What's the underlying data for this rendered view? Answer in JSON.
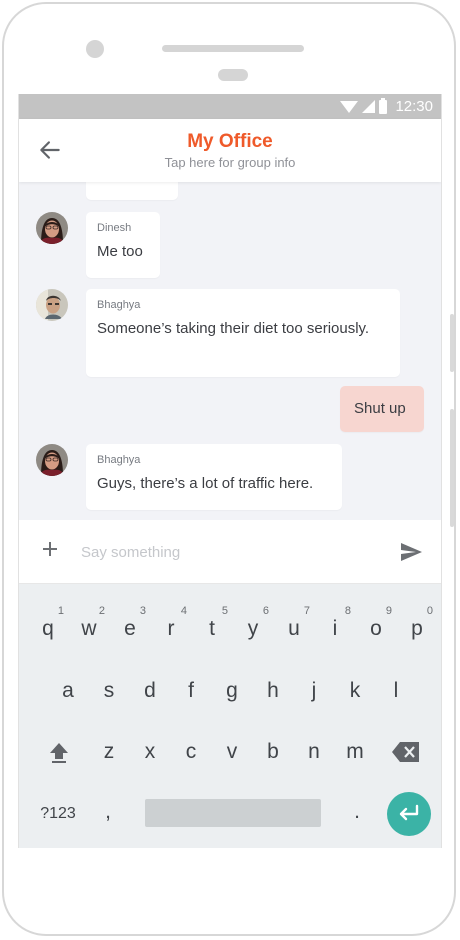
{
  "status_bar": {
    "time": "12:30"
  },
  "header": {
    "title": "My Office",
    "subtitle": "Tap here for group info"
  },
  "messages": [
    {
      "sender": "",
      "text": ""
    },
    {
      "sender": "Dinesh",
      "text": "Me too"
    },
    {
      "sender": "Bhaghya",
      "text": "Someone’s taking their diet too seriously."
    },
    {
      "sender": "",
      "text": "Shut up",
      "outgoing": true
    },
    {
      "sender": "Bhaghya",
      "text": "Guys, there’s a lot of traffic here."
    }
  ],
  "composer": {
    "placeholder": "Say something"
  },
  "keyboard": {
    "row1": [
      "q",
      "w",
      "e",
      "r",
      "t",
      "y",
      "u",
      "i",
      "o",
      "p"
    ],
    "row1_hints": [
      "1",
      "2",
      "3",
      "4",
      "5",
      "6",
      "7",
      "8",
      "9",
      "0"
    ],
    "row2": [
      "a",
      "s",
      "d",
      "f",
      "g",
      "h",
      "j",
      "k",
      "l"
    ],
    "row3": [
      "z",
      "x",
      "c",
      "v",
      "b",
      "n",
      "m"
    ],
    "symbols_label": "?123",
    "comma": ",",
    "period": "."
  },
  "colors": {
    "accent": "#ef5a2a",
    "sent_bubble": "#f7d6d0",
    "enter": "#3bb3a6"
  }
}
